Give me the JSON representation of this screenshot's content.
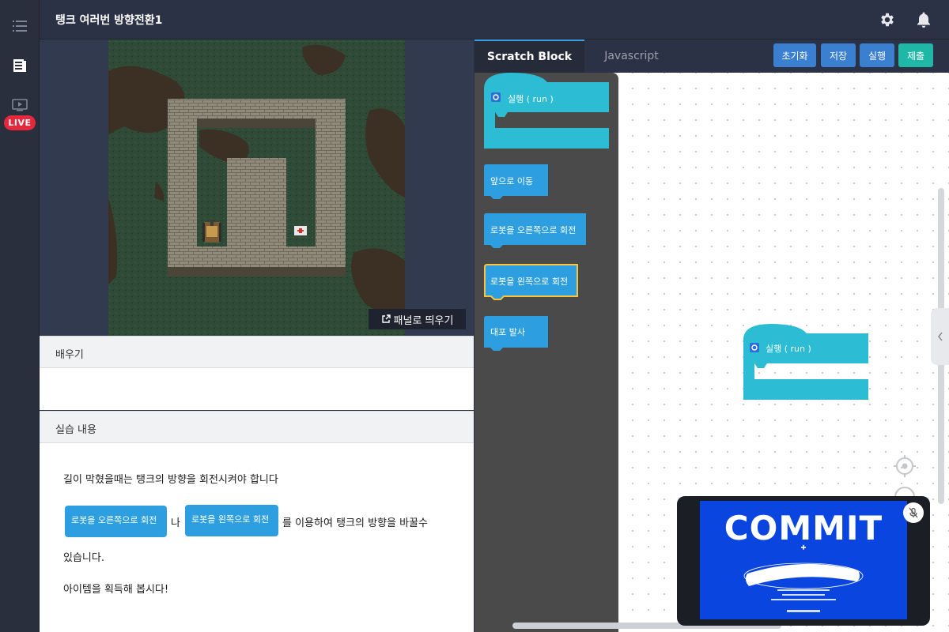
{
  "rail": {
    "live_label": "LIVE"
  },
  "header": {
    "title": "탱크 여러번 방향전환1"
  },
  "game": {
    "popout_label": "패널로 띄우기"
  },
  "learn": {
    "heading": "배우기"
  },
  "practice": {
    "heading": "실습 내용",
    "line1": "길이 막혔을때는 탱크의 방향을 회전시켜야 합니다",
    "block_right": "로봇을 오른쪽으로 회전",
    "conj": "나",
    "block_left": "로봇을 왼쪽으로 회전",
    "line2_tail": "를 이용하여 탱크의 방향을 바꿀수",
    "line3": "있습니다.",
    "line4": "아이템을 획득해 봅시다!"
  },
  "editor": {
    "tabs": [
      {
        "label": "Scratch Block"
      },
      {
        "label": "Javascript"
      }
    ],
    "actions": {
      "reset": "초기화",
      "save": "저장",
      "run": "실행",
      "submit": "제출"
    },
    "flyout_blocks": {
      "run": "실행 (  run  )",
      "forward": "앞으로 이동",
      "turn_right": "로봇을 오른쪽으로 회전",
      "turn_left": "로봇을 왼쪽으로 회전",
      "fire": "대포 발사"
    },
    "workspace_block": "실행 (  run  )"
  },
  "video": {
    "title_text": "COMMIT"
  },
  "colors": {
    "accent_blue": "#3b7fd1",
    "submit_teal": "#1fb8a6",
    "block_cyan": "#2cbcd3",
    "block_blue": "#2d9fe0",
    "live_red": "#e5283c"
  }
}
